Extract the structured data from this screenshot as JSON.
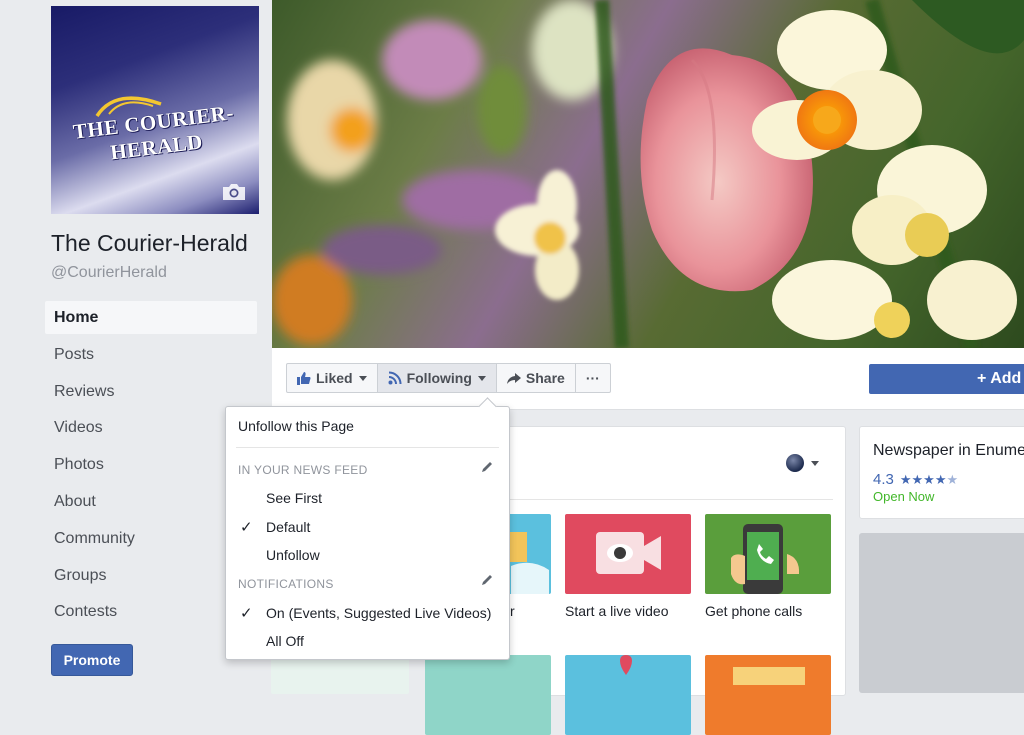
{
  "sidebar": {
    "logo_text": "THE COURIER-HERALD",
    "page_name": "The Courier-Herald",
    "page_handle": "@CourierHerald",
    "nav": [
      {
        "label": "Home",
        "active": true
      },
      {
        "label": "Posts"
      },
      {
        "label": "Reviews"
      },
      {
        "label": "Videos"
      },
      {
        "label": "Photos"
      },
      {
        "label": "About"
      },
      {
        "label": "Community"
      },
      {
        "label": "Groups"
      },
      {
        "label": "Contests"
      }
    ],
    "promote_label": "Promote"
  },
  "action_bar": {
    "liked_label": "Liked",
    "following_label": "Following",
    "share_label": "Share",
    "more_label": "···",
    "add_label": "+ Add"
  },
  "dropdown": {
    "unfollow_page": "Unfollow this Page",
    "news_feed_header": "IN YOUR NEWS FEED",
    "see_first": "See First",
    "default": "Default",
    "unfollow": "Unfollow",
    "notifications_header": "NOTIFICATIONS",
    "notif_on": "On (Events, Suggested Live Videos)",
    "all_off": "All Off"
  },
  "card": {
    "tiles": [
      {
        "label": "r",
        "color": "#5bc0de"
      },
      {
        "label": "Start a live video",
        "color": "#e04a5f"
      },
      {
        "label": "Get phone calls",
        "color": "#5a9e3c"
      }
    ]
  },
  "right_card": {
    "title": "Newspaper in Enume",
    "rating": "4.3",
    "stars": "★★★★",
    "half_star": "★",
    "status": "Open Now"
  },
  "colors": {
    "accent": "#4267b2",
    "success": "#42b72a"
  }
}
